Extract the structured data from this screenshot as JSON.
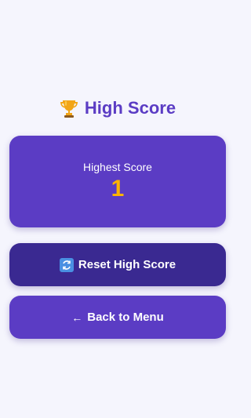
{
  "header": {
    "icon": "trophy-icon",
    "title": "High Score"
  },
  "score_card": {
    "label": "Highest Score",
    "value": "1"
  },
  "buttons": {
    "reset": {
      "icon": "reset-icon",
      "label": "Reset High Score"
    },
    "back": {
      "icon": "left-arrow-icon",
      "label": "Back to Menu"
    }
  },
  "colors": {
    "background": "#f5f5fd",
    "primary": "#5b3cc4",
    "primary_dark": "#3a2991",
    "score": "#ffb300",
    "title": "#5b3cc4"
  }
}
